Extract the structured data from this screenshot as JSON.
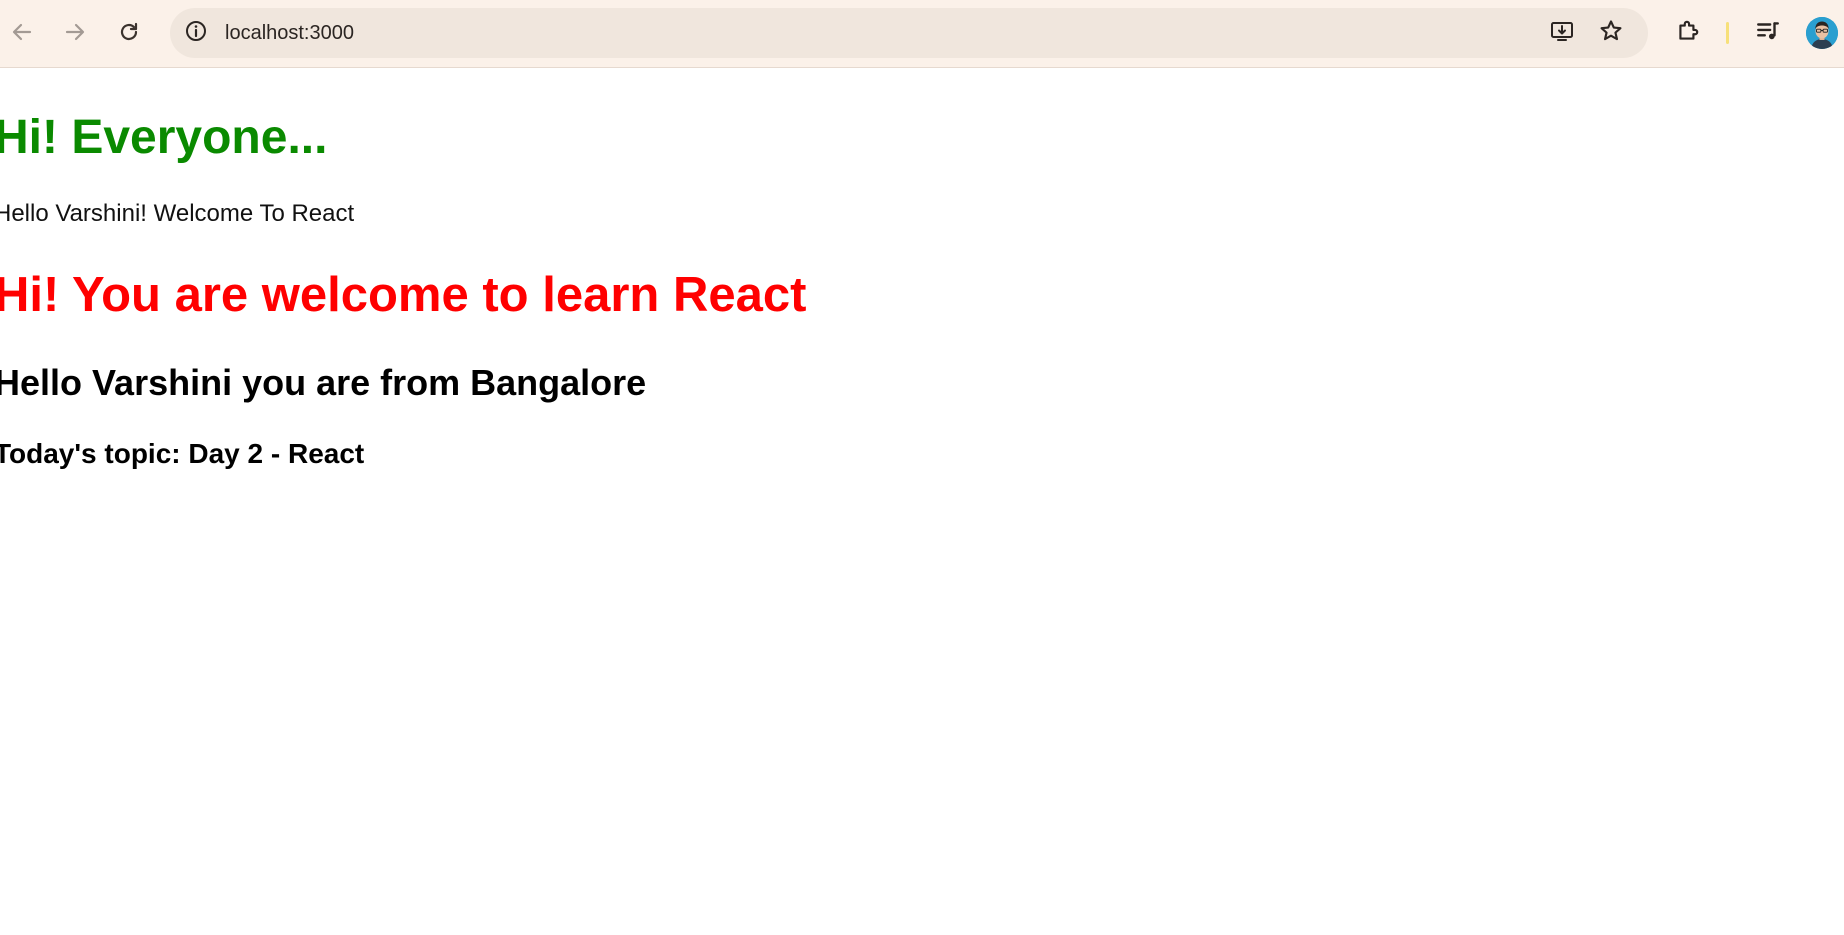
{
  "browser": {
    "url": "localhost:3000",
    "icons": {
      "back": "arrow-left-icon",
      "forward": "arrow-right-icon",
      "reload": "reload-icon",
      "site_info": "info-icon",
      "install": "install-app-icon",
      "bookmark": "star-icon",
      "extensions": "puzzle-icon",
      "media": "media-controls-icon",
      "profile": "avatar"
    },
    "colors": {
      "toolbar": "#fbf1e9",
      "omnibox": "#f0e6dd"
    }
  },
  "content": {
    "heading_green": "Hi! Everyone...",
    "welcome_text": "Hello Varshini! Welcome To React",
    "heading_red": "Hi! You are welcome to learn React",
    "heading_location": "Hello Varshini you are from Bangalore",
    "heading_topic": "Today's topic: Day 2 - React",
    "colors": {
      "green_heading": "#0a8a00",
      "red_heading": "#ff0000"
    }
  }
}
